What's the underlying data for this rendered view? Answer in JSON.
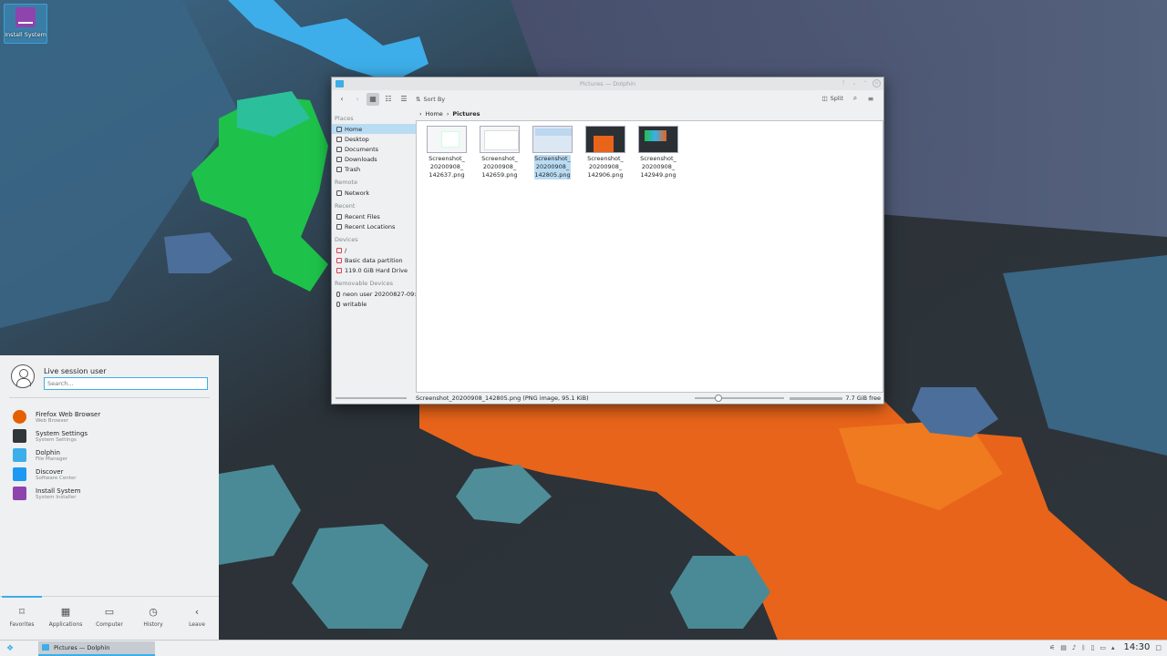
{
  "desktop": {
    "icon_label": "Install System"
  },
  "window": {
    "title": "Pictures — Dolphin",
    "toolbar": {
      "back": "‹",
      "forward": "›",
      "sort_by": "Sort By",
      "split": "Split"
    },
    "places": [
      {
        "section": "Places",
        "items": [
          "Home",
          "Desktop",
          "Documents",
          "Downloads",
          "Trash"
        ]
      },
      {
        "section": "Remote",
        "items": [
          "Network"
        ]
      },
      {
        "section": "Recent",
        "items": [
          "Recent Files",
          "Recent Locations"
        ]
      },
      {
        "section": "Devices",
        "items": [
          "/",
          "Basic data partition",
          "119.0 GiB Hard Drive"
        ]
      },
      {
        "section": "Removable Devices",
        "items": [
          "neon user 20200827-09:5",
          "writable"
        ]
      }
    ],
    "selected_place": "Home",
    "breadcrumb": {
      "home": "Home",
      "current": "Pictures"
    },
    "files": [
      {
        "name_lines": [
          "Screenshot_",
          "20200908_",
          "142637.png"
        ],
        "selected": false
      },
      {
        "name_lines": [
          "Screenshot_",
          "20200908_",
          "142659.png"
        ],
        "selected": false
      },
      {
        "name_lines": [
          "Screenshot_",
          "20200908_",
          "142805.png"
        ],
        "selected": true
      },
      {
        "name_lines": [
          "Screenshot_",
          "20200908_",
          "142906.png"
        ],
        "selected": false
      },
      {
        "name_lines": [
          "Screenshot_",
          "20200908_",
          "142949.png"
        ],
        "selected": false
      }
    ],
    "status": {
      "message": "Screenshot_20200908_142805.png (PNG image, 95.1 KiB)",
      "free": "7.7 GiB free"
    }
  },
  "launcher": {
    "user": "Live session user",
    "search_placeholder": "Search...",
    "favorites": [
      {
        "name": "Firefox Web Browser",
        "sub": "Web Browser",
        "color": "#e66000"
      },
      {
        "name": "System Settings",
        "sub": "System Settings",
        "color": "#31363b"
      },
      {
        "name": "Dolphin",
        "sub": "File Manager",
        "color": "#3daee9"
      },
      {
        "name": "Discover",
        "sub": "Software Center",
        "color": "#1d99f3"
      },
      {
        "name": "Install System",
        "sub": "System Installer",
        "color": "#8e44ad"
      }
    ],
    "tabs": [
      {
        "label": "Favorites",
        "icon": "bookmark-icon",
        "active": true
      },
      {
        "label": "Applications",
        "icon": "grid-icon",
        "active": false
      },
      {
        "label": "Computer",
        "icon": "monitor-icon",
        "active": false
      },
      {
        "label": "History",
        "icon": "clock-icon",
        "active": false
      },
      {
        "label": "Leave",
        "icon": "leave-icon",
        "active": false
      }
    ]
  },
  "panel": {
    "task_label": "Pictures — Dolphin",
    "clock": "14:30"
  },
  "colors": {
    "accent": "#3daee9",
    "selection": "#b9dcf3"
  }
}
